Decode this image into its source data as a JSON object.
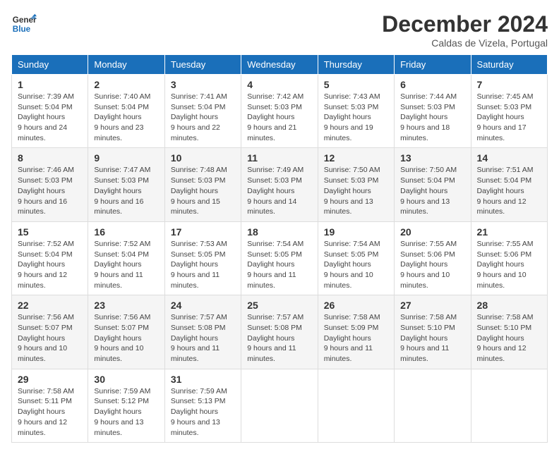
{
  "logo": {
    "line1": "General",
    "line2": "Blue"
  },
  "title": "December 2024",
  "subtitle": "Caldas de Vizela, Portugal",
  "days_of_week": [
    "Sunday",
    "Monday",
    "Tuesday",
    "Wednesday",
    "Thursday",
    "Friday",
    "Saturday"
  ],
  "weeks": [
    [
      {
        "day": "1",
        "sunrise": "7:39 AM",
        "sunset": "5:04 PM",
        "daylight": "9 hours and 24 minutes."
      },
      {
        "day": "2",
        "sunrise": "7:40 AM",
        "sunset": "5:04 PM",
        "daylight": "9 hours and 23 minutes."
      },
      {
        "day": "3",
        "sunrise": "7:41 AM",
        "sunset": "5:04 PM",
        "daylight": "9 hours and 22 minutes."
      },
      {
        "day": "4",
        "sunrise": "7:42 AM",
        "sunset": "5:03 PM",
        "daylight": "9 hours and 21 minutes."
      },
      {
        "day": "5",
        "sunrise": "7:43 AM",
        "sunset": "5:03 PM",
        "daylight": "9 hours and 19 minutes."
      },
      {
        "day": "6",
        "sunrise": "7:44 AM",
        "sunset": "5:03 PM",
        "daylight": "9 hours and 18 minutes."
      },
      {
        "day": "7",
        "sunrise": "7:45 AM",
        "sunset": "5:03 PM",
        "daylight": "9 hours and 17 minutes."
      }
    ],
    [
      {
        "day": "8",
        "sunrise": "7:46 AM",
        "sunset": "5:03 PM",
        "daylight": "9 hours and 16 minutes."
      },
      {
        "day": "9",
        "sunrise": "7:47 AM",
        "sunset": "5:03 PM",
        "daylight": "9 hours and 16 minutes."
      },
      {
        "day": "10",
        "sunrise": "7:48 AM",
        "sunset": "5:03 PM",
        "daylight": "9 hours and 15 minutes."
      },
      {
        "day": "11",
        "sunrise": "7:49 AM",
        "sunset": "5:03 PM",
        "daylight": "9 hours and 14 minutes."
      },
      {
        "day": "12",
        "sunrise": "7:50 AM",
        "sunset": "5:03 PM",
        "daylight": "9 hours and 13 minutes."
      },
      {
        "day": "13",
        "sunrise": "7:50 AM",
        "sunset": "5:04 PM",
        "daylight": "9 hours and 13 minutes."
      },
      {
        "day": "14",
        "sunrise": "7:51 AM",
        "sunset": "5:04 PM",
        "daylight": "9 hours and 12 minutes."
      }
    ],
    [
      {
        "day": "15",
        "sunrise": "7:52 AM",
        "sunset": "5:04 PM",
        "daylight": "9 hours and 12 minutes."
      },
      {
        "day": "16",
        "sunrise": "7:52 AM",
        "sunset": "5:04 PM",
        "daylight": "9 hours and 11 minutes."
      },
      {
        "day": "17",
        "sunrise": "7:53 AM",
        "sunset": "5:05 PM",
        "daylight": "9 hours and 11 minutes."
      },
      {
        "day": "18",
        "sunrise": "7:54 AM",
        "sunset": "5:05 PM",
        "daylight": "9 hours and 11 minutes."
      },
      {
        "day": "19",
        "sunrise": "7:54 AM",
        "sunset": "5:05 PM",
        "daylight": "9 hours and 10 minutes."
      },
      {
        "day": "20",
        "sunrise": "7:55 AM",
        "sunset": "5:06 PM",
        "daylight": "9 hours and 10 minutes."
      },
      {
        "day": "21",
        "sunrise": "7:55 AM",
        "sunset": "5:06 PM",
        "daylight": "9 hours and 10 minutes."
      }
    ],
    [
      {
        "day": "22",
        "sunrise": "7:56 AM",
        "sunset": "5:07 PM",
        "daylight": "9 hours and 10 minutes."
      },
      {
        "day": "23",
        "sunrise": "7:56 AM",
        "sunset": "5:07 PM",
        "daylight": "9 hours and 10 minutes."
      },
      {
        "day": "24",
        "sunrise": "7:57 AM",
        "sunset": "5:08 PM",
        "daylight": "9 hours and 11 minutes."
      },
      {
        "day": "25",
        "sunrise": "7:57 AM",
        "sunset": "5:08 PM",
        "daylight": "9 hours and 11 minutes."
      },
      {
        "day": "26",
        "sunrise": "7:58 AM",
        "sunset": "5:09 PM",
        "daylight": "9 hours and 11 minutes."
      },
      {
        "day": "27",
        "sunrise": "7:58 AM",
        "sunset": "5:10 PM",
        "daylight": "9 hours and 11 minutes."
      },
      {
        "day": "28",
        "sunrise": "7:58 AM",
        "sunset": "5:10 PM",
        "daylight": "9 hours and 12 minutes."
      }
    ],
    [
      {
        "day": "29",
        "sunrise": "7:58 AM",
        "sunset": "5:11 PM",
        "daylight": "9 hours and 12 minutes."
      },
      {
        "day": "30",
        "sunrise": "7:59 AM",
        "sunset": "5:12 PM",
        "daylight": "9 hours and 13 minutes."
      },
      {
        "day": "31",
        "sunrise": "7:59 AM",
        "sunset": "5:13 PM",
        "daylight": "9 hours and 13 minutes."
      },
      null,
      null,
      null,
      null
    ]
  ]
}
